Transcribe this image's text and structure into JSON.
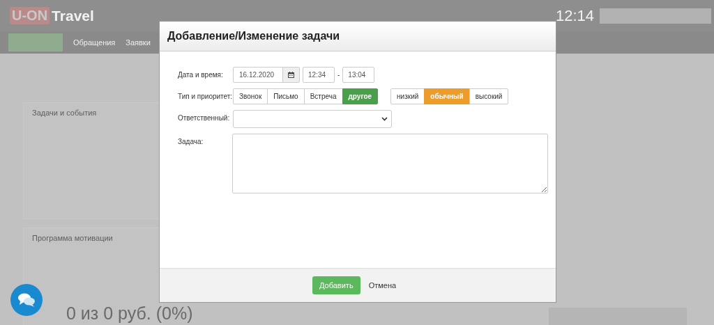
{
  "app": {
    "logo": {
      "mark": "U-ON",
      "text": "Travel"
    },
    "time": "12:14",
    "nav": [
      {
        "label": "Обращения"
      },
      {
        "label": "Заявки"
      }
    ]
  },
  "panels": [
    {
      "title": "Задачи и события"
    },
    {
      "title": "Программа мотивации",
      "stat": "0 из 0 руб. (0%)"
    }
  ],
  "modal": {
    "title": "Добавление/Изменение задачи",
    "date_row": {
      "label": "Дата и время:",
      "date": "16.12.2020",
      "time_from": "12:34",
      "separator": "-",
      "time_to": "13:04"
    },
    "type_row": {
      "label": "Тип и приоритет:",
      "types": [
        {
          "label": "Звонок",
          "selected": false
        },
        {
          "label": "Письмо",
          "selected": false
        },
        {
          "label": "Встреча",
          "selected": false
        },
        {
          "label": "другое",
          "selected": true
        }
      ],
      "priorities": [
        {
          "label": "низкий",
          "selected": false
        },
        {
          "label": "обычный",
          "selected": true
        },
        {
          "label": "высокий",
          "selected": false
        }
      ]
    },
    "assignee_row": {
      "label": "Ответственный:"
    },
    "task_row": {
      "label": "Задача:"
    },
    "buttons": [
      {
        "label": "Добавить",
        "kind": "primary"
      },
      {
        "label": "Отмена",
        "kind": "link"
      }
    ]
  }
}
